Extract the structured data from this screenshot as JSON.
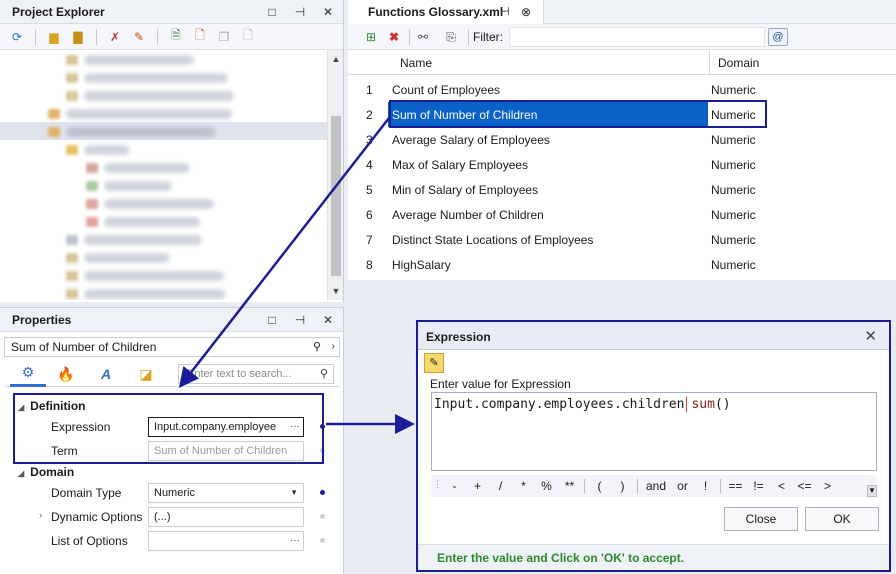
{
  "explorer": {
    "title": "Project Explorer",
    "controls": [
      "□",
      "⊣",
      "✕"
    ]
  },
  "properties": {
    "title": "Properties",
    "controls": [
      "□",
      "⊣",
      "✕"
    ],
    "object_name": "Sum of Number of Children",
    "search_placeholder": "Enter text to search...",
    "categories": {
      "definition": "Definition",
      "domain": "Domain"
    },
    "fields": {
      "expression_label": "Expression",
      "expression_value": "Input.company.employee",
      "term_label": "Term",
      "term_value": "Sum of Number of Children",
      "domain_type_label": "Domain Type",
      "domain_type_value": "Numeric",
      "dynamic_options_label": "Dynamic Options",
      "dynamic_options_value": "(...)",
      "list_options_label": "List of Options",
      "list_options_value": ""
    }
  },
  "glossary": {
    "tab_title": "Functions Glossary.xml",
    "filter_label": "Filter:",
    "filter_value": "",
    "columns": {
      "name": "Name",
      "domain": "Domain"
    },
    "rows": [
      {
        "num": "1",
        "name": "Count of Employees",
        "domain": "Numeric"
      },
      {
        "num": "2",
        "name": "Sum of Number of Children",
        "domain": "Numeric"
      },
      {
        "num": "3",
        "name": "Average Salary of Employees",
        "domain": "Numeric"
      },
      {
        "num": "4",
        "name": "Max of Salary Employees",
        "domain": "Numeric"
      },
      {
        "num": "5",
        "name": "Min of Salary of Employees",
        "domain": "Numeric"
      },
      {
        "num": "6",
        "name": "Average Number of Children",
        "domain": "Numeric"
      },
      {
        "num": "7",
        "name": "Distinct State Locations of Employees",
        "domain": "Numeric"
      },
      {
        "num": "8",
        "name": "HighSalary",
        "domain": "Numeric"
      }
    ],
    "selected_row": 2
  },
  "expression_dialog": {
    "title": "Expression",
    "close": "✕",
    "prompt": "Enter value for Expression",
    "code_main": "Input.company.employees.children",
    "code_func": "sum",
    "code_parens": "()",
    "operators": [
      "-",
      "+",
      "/",
      "*",
      "%",
      "**",
      "(",
      ")",
      "and",
      "or",
      "!",
      "==",
      "!=",
      "<",
      "<=",
      ">"
    ],
    "close_button": "Close",
    "ok_button": "OK",
    "footer": "Enter the value and Click on 'OK' to accept."
  },
  "colors": {
    "selection": "#0a62c9",
    "annotation": "#1c1c96",
    "footer_text": "#2c8a2c"
  }
}
